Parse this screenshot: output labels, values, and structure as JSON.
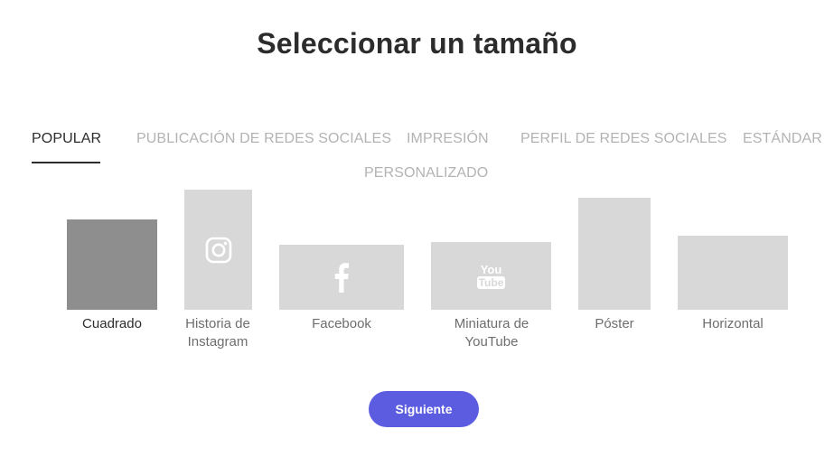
{
  "title": "Seleccionar un tamaño",
  "tabs": [
    {
      "label": "POPULAR",
      "active": true
    },
    {
      "label": "PUBLICACIÓN DE REDES SOCIALES",
      "active": false
    },
    {
      "label": "IMPRESIÓN",
      "active": false
    },
    {
      "label": "PERFIL DE REDES SOCIALES",
      "active": false
    },
    {
      "label": "ESTÁNDAR",
      "active": false
    },
    {
      "label": "PERSONALIZADO",
      "active": false
    }
  ],
  "sizes": [
    {
      "label": "Cuadrado",
      "icon": null,
      "selected": true
    },
    {
      "label": "Historia de Instagram",
      "icon": "instagram-icon",
      "selected": false
    },
    {
      "label": "Facebook",
      "icon": "facebook-icon",
      "selected": false
    },
    {
      "label": "Miniatura de YouTube",
      "icon": "youtube-icon",
      "selected": false
    },
    {
      "label": "Póster",
      "icon": null,
      "selected": false
    },
    {
      "label": "Horizontal",
      "icon": null,
      "selected": false
    }
  ],
  "youtube_icon_text": {
    "top": "You",
    "bottom": "Tube"
  },
  "next_button": "Siguiente",
  "colors": {
    "accent": "#5c5ce0",
    "selected_card": "#8e8e8e",
    "card": "#d8d8d8",
    "inactive_tab": "#b3b3b3"
  }
}
